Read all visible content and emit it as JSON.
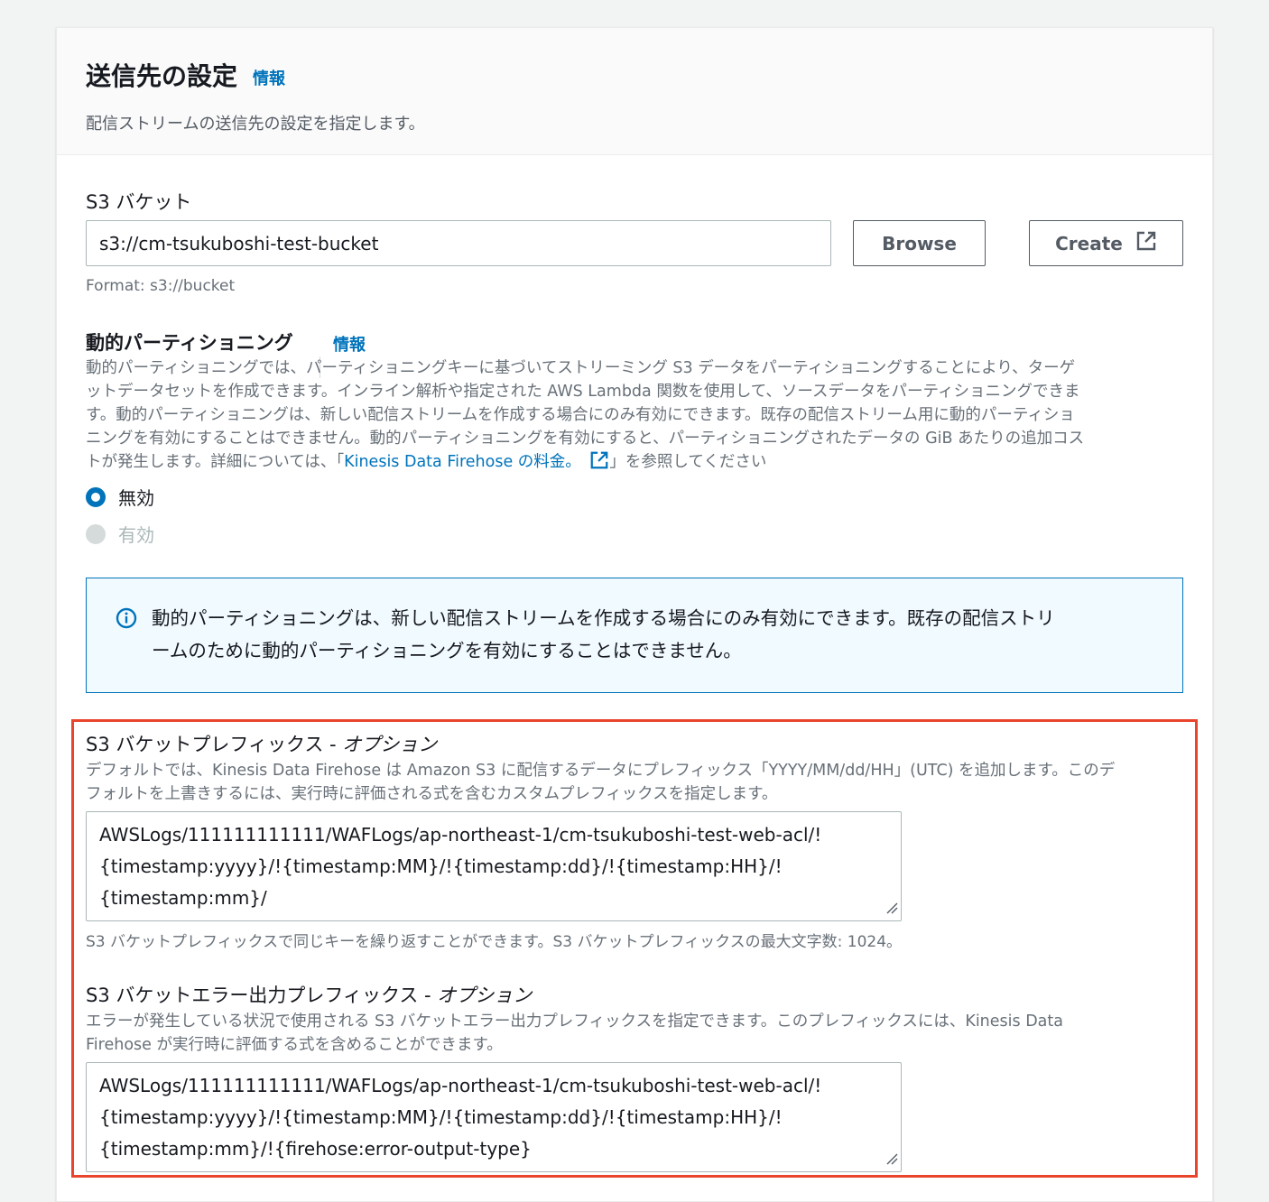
{
  "header": {
    "title": "送信先の設定",
    "info": "情報",
    "description": "配信ストリームの送信先の設定を指定します。"
  },
  "s3_bucket": {
    "label": "S3 バケット",
    "value": "s3://cm-tsukuboshi-test-bucket",
    "browse_label": "Browse",
    "create_label": "Create",
    "format_hint": "Format: s3://bucket"
  },
  "dynamic_partitioning": {
    "label": "動的パーティショニング",
    "info": "情報",
    "description_lines": [
      "動的パーティショニングでは、パーティショニングキーに基づいてストリーミング S3 データをパーティショニングすることにより、ターゲ",
      "ットデータセットを作成できます。インライン解析や指定された AWS Lambda 関数を使用して、ソースデータをパーティショニングできま",
      "す。動的パーティショニングは、新しい配信ストリームを作成する場合にのみ有効にできます。既存の配信ストリーム用に動的パーティショ",
      "ニングを有効にすることはできません。動的パーティショニングを有効にすると、パーティショニングされたデータの GiB あたりの追加コス"
    ],
    "description_last_pre": "トが発生します。詳細については、「",
    "description_link": "Kinesis Data Firehose の料金。",
    "description_last_post": "」を参照してください",
    "options": [
      "無効",
      "有効"
    ],
    "selected": "無効",
    "alert": {
      "lines": [
        "動的パーティショニングは、新しい配信ストリームを作成する場合にのみ有効にできます。既存の配信ストリ",
        "ームのために動的パーティショニングを有効にすることはできません。"
      ]
    }
  },
  "prefix": {
    "label": "S3 バケットプレフィックス - ",
    "label_optional": "オプション",
    "description_lines": [
      "デフォルトでは、Kinesis Data Firehose は Amazon S3 に配信するデータにプレフィックス「YYYY/MM/dd/HH」(UTC) を追加します。このデ",
      "フォルトを上書きするには、実行時に評価される式を含むカスタムプレフィックスを指定します。"
    ],
    "value_lines": [
      "AWSLogs/111111111111/WAFLogs/ap-northeast-1/cm-tsukuboshi-test-web-acl/!",
      "{timestamp:yyyy}/!{timestamp:MM}/!{timestamp:dd}/!{timestamp:HH}/!",
      "{timestamp:mm}/"
    ],
    "hint": "S3 バケットプレフィックスで同じキーを繰り返すことができます。S3 バケットプレフィックスの最大文字数: 1024。"
  },
  "error_prefix": {
    "label": "S3 バケットエラー出力プレフィックス - ",
    "label_optional": "オプション",
    "description_lines": [
      "エラーが発生している状況で使用される S3 バケットエラー出力プレフィックスを指定できます。このプレフィックスには、Kinesis Data",
      "Firehose が実行時に評価する式を含めることができます。"
    ],
    "value_lines": [
      "AWSLogs/111111111111/WAFLogs/ap-northeast-1/cm-tsukuboshi-test-web-acl/!",
      "{timestamp:yyyy}/!{timestamp:MM}/!{timestamp:dd}/!{timestamp:HH}/!",
      "{timestamp:mm}/!{firehose:error-output-type}"
    ]
  },
  "colors": {
    "link": "#0073bb",
    "highlight": "#e8452c",
    "alert_bg": "#f1faff"
  },
  "icons": {
    "external_link": "external-link-icon",
    "info": "info-circle-icon",
    "resize": "resize-handle-icon"
  }
}
